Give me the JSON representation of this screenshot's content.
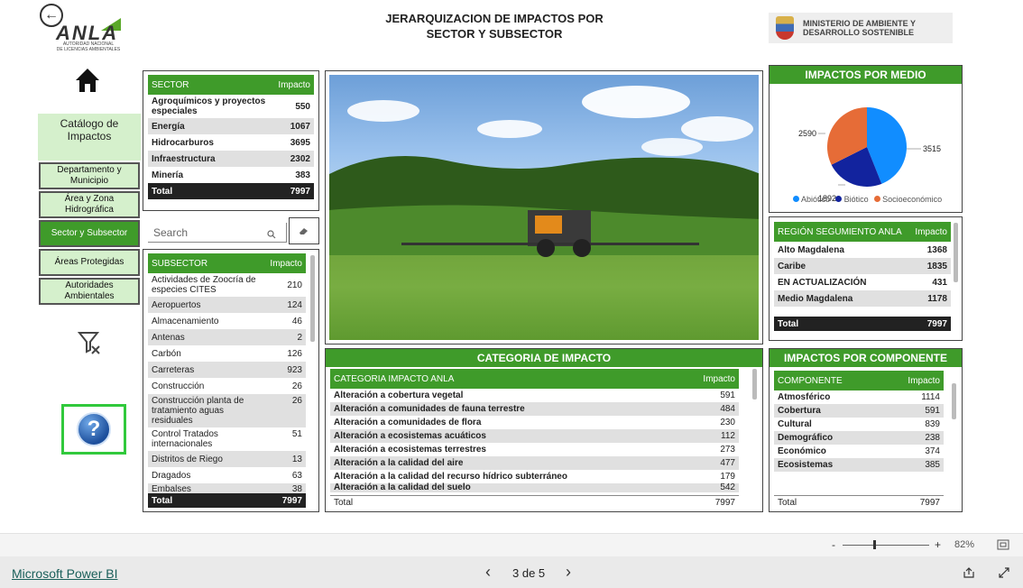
{
  "header": {
    "title_line1": "JERARQUIZACION DE IMPACTOS POR",
    "title_line2": "SECTOR Y SUBSECTOR",
    "logo_text": "ANLA",
    "logo_subtitle_line1": "AUTORIDAD NACIONAL",
    "logo_subtitle_line2": "DE LICENCIAS AMBIENTALES",
    "ministry_line1": "MINISTERIO DE AMBIENTE Y",
    "ministry_line2": "DESARROLLO SOSTENIBLE"
  },
  "nav": {
    "catalog_label": "Catálogo de Impactos",
    "items": [
      {
        "label": "Departamento y Municipio"
      },
      {
        "label": "Área y Zona Hidrográfica"
      },
      {
        "label": "Sector y Subsector"
      },
      {
        "label": "Áreas Protegidas"
      },
      {
        "label": "Autoridades Ambientales"
      }
    ],
    "help_label": "?"
  },
  "sector_table": {
    "headers": [
      "SECTOR",
      "Impacto"
    ],
    "rows": [
      [
        "Agroquímicos y proyectos especiales",
        "550"
      ],
      [
        "Energía",
        "1067"
      ],
      [
        "Hidrocarburos",
        "3695"
      ],
      [
        "Infraestructura",
        "2302"
      ],
      [
        "Minería",
        "383"
      ]
    ],
    "total": [
      "Total",
      "7997"
    ]
  },
  "search": {
    "placeholder": "Search"
  },
  "subsector_table": {
    "headers": [
      "SUBSECTOR",
      "Impacto"
    ],
    "rows": [
      [
        "Actividades de Zoocría de especies CITES",
        "210"
      ],
      [
        "Aeropuertos",
        "124"
      ],
      [
        "Almacenamiento",
        "46"
      ],
      [
        "Antenas",
        "2"
      ],
      [
        "Carbón",
        "126"
      ],
      [
        "Carreteras",
        "923"
      ],
      [
        "Construcción",
        "26"
      ],
      [
        "Construcción planta de tratamiento aguas residuales",
        "26"
      ],
      [
        "Control Tratados internacionales",
        "51"
      ],
      [
        "Distritos de Riego",
        "13"
      ],
      [
        "Dragados",
        "63"
      ],
      [
        "Embalses",
        "38"
      ]
    ],
    "total": [
      "Total",
      "7997"
    ]
  },
  "categoria": {
    "title": "CATEGORIA DE IMPACTO",
    "headers": [
      "CATEGORIA IMPACTO ANLA",
      "Impacto"
    ],
    "rows": [
      [
        "Alteración a cobertura vegetal",
        "591"
      ],
      [
        "Alteración a comunidades de fauna terrestre",
        "484"
      ],
      [
        "Alteración a comunidades de flora",
        "230"
      ],
      [
        "Alteración a ecosistemas acuáticos",
        "112"
      ],
      [
        "Alteración a ecosistemas terrestres",
        "273"
      ],
      [
        "Alteración a la calidad del aire",
        "477"
      ],
      [
        "Alteración a la calidad del recurso hídrico subterráneo",
        "179"
      ],
      [
        "Alteración a la calidad del suelo",
        "542"
      ]
    ],
    "total": [
      "Total",
      "7997"
    ]
  },
  "pie": {
    "title": "IMPACTOS POR MEDIO",
    "labels": {
      "abiotico": "3515",
      "biotico": "1892",
      "socio": "2590"
    },
    "legend": [
      "Abiótico",
      "Biótico",
      "Socioeconómico"
    ],
    "colors": {
      "abiotico": "#118dff",
      "biotico": "#12239e",
      "socio": "#e66c37"
    }
  },
  "chart_data": {
    "type": "pie",
    "title": "IMPACTOS POR MEDIO",
    "categories": [
      "Abiótico",
      "Biótico",
      "Socioeconómico"
    ],
    "values": [
      3515,
      1892,
      2590
    ],
    "legend": "bottom"
  },
  "region_table": {
    "headers": [
      "REGIÓN SEGUMIENTO ANLA",
      "Impacto"
    ],
    "rows": [
      [
        "Alto Magdalena",
        "1368"
      ],
      [
        "Caribe",
        "1835"
      ],
      [
        "EN ACTUALIZACIÓN",
        "431"
      ],
      [
        "Medio Magdalena",
        "1178"
      ]
    ],
    "total": [
      "Total",
      "7997"
    ]
  },
  "componente": {
    "title": "IMPACTOS POR COMPONENTE",
    "headers": [
      "COMPONENTE",
      "Impacto"
    ],
    "rows": [
      [
        "Atmosférico",
        "1114"
      ],
      [
        "Cobertura",
        "591"
      ],
      [
        "Cultural",
        "839"
      ],
      [
        "Demográfico",
        "238"
      ],
      [
        "Económico",
        "374"
      ],
      [
        "Ecosistemas",
        "385"
      ]
    ],
    "total": [
      "Total",
      "7997"
    ]
  },
  "zoom": {
    "minus": "-",
    "plus": "+",
    "level": "82%"
  },
  "footer": {
    "brand": "Microsoft Power BI",
    "page_indicator": "3 de 5",
    "prev": "‹",
    "next": "›"
  }
}
